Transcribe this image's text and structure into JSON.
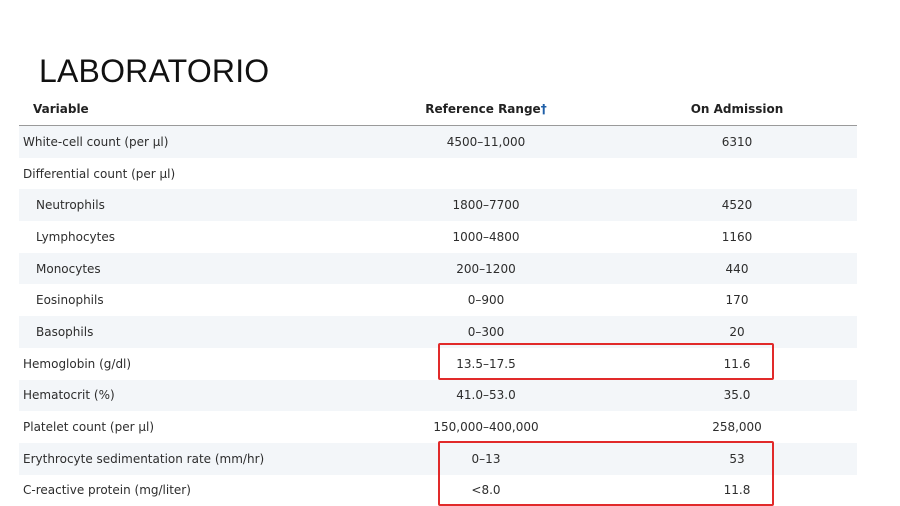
{
  "title": "LABORATORIO",
  "table": {
    "headers": {
      "variable": "Variable",
      "reference": "Reference Range",
      "reference_mark": "†",
      "admission": "On Admission"
    },
    "rows": [
      {
        "variable": "White-cell count (per µl)",
        "reference": "4500–11,000",
        "admission": "6310",
        "indent": false
      },
      {
        "variable": "Differential count (per µl)",
        "reference": "",
        "admission": "",
        "indent": false
      },
      {
        "variable": "Neutrophils",
        "reference": "1800–7700",
        "admission": "4520",
        "indent": true
      },
      {
        "variable": "Lymphocytes",
        "reference": "1000–4800",
        "admission": "1160",
        "indent": true
      },
      {
        "variable": "Monocytes",
        "reference": "200–1200",
        "admission": "440",
        "indent": true
      },
      {
        "variable": "Eosinophils",
        "reference": "0–900",
        "admission": "170",
        "indent": true
      },
      {
        "variable": "Basophils",
        "reference": "0–300",
        "admission": "20",
        "indent": true
      },
      {
        "variable": "Hemoglobin (g/dl)",
        "reference": "13.5–17.5",
        "admission": "11.6",
        "indent": false
      },
      {
        "variable": "Hematocrit (%)",
        "reference": "41.0–53.0",
        "admission": "35.0",
        "indent": false
      },
      {
        "variable": "Platelet count (per µl)",
        "reference": "150,000–400,000",
        "admission": "258,000",
        "indent": false
      },
      {
        "variable": "Erythrocyte sedimentation rate (mm/hr)",
        "reference": "0–13",
        "admission": "53",
        "indent": false
      },
      {
        "variable": "C-reactive protein (mg/liter)",
        "reference": "<8.0",
        "admission": "11.8",
        "indent": false
      }
    ]
  },
  "colors": {
    "highlight": "#e12a2a",
    "row_shade": "#f3f6f9",
    "dagger": "#1f5fa8"
  }
}
